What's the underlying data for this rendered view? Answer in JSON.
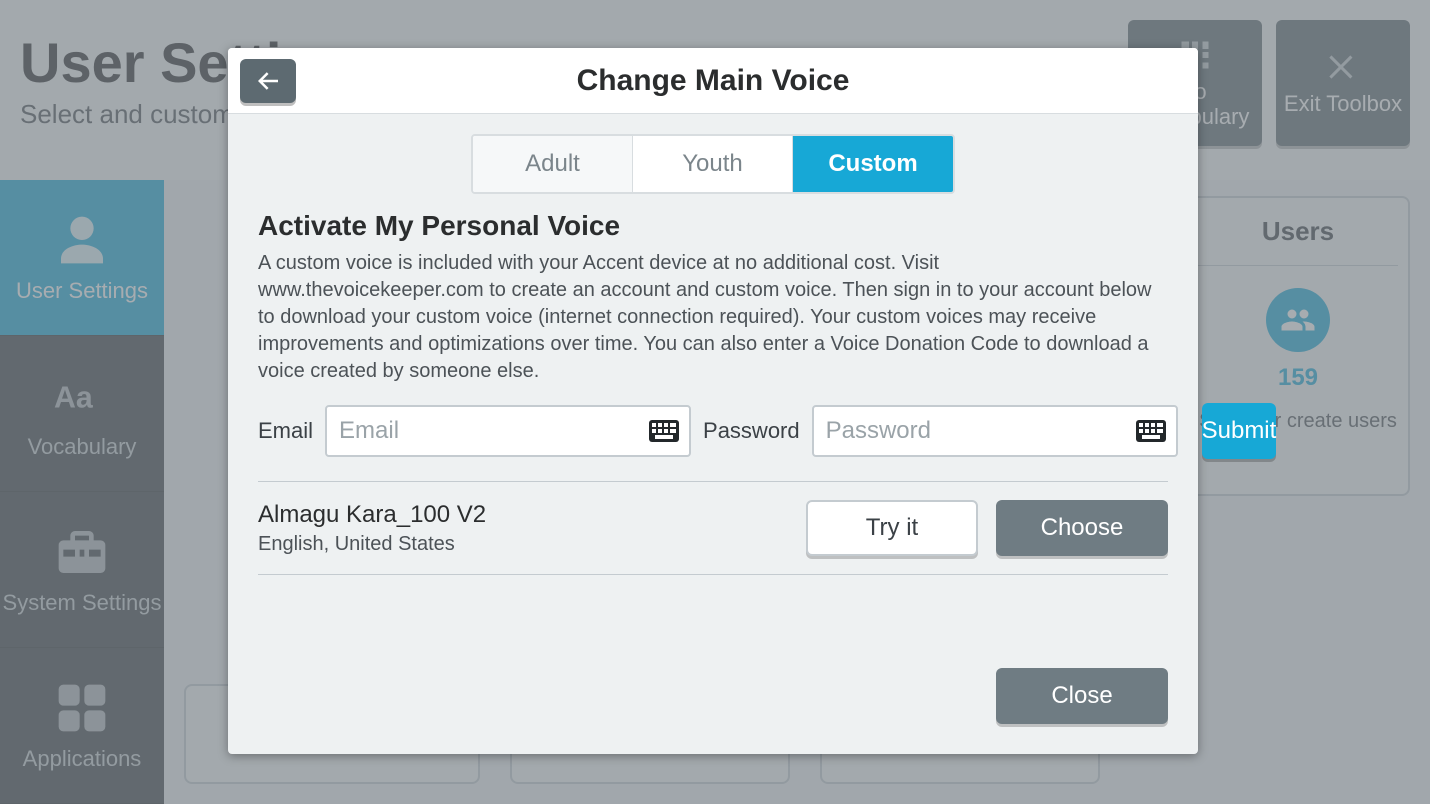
{
  "background": {
    "title": "User Settings",
    "subtitle": "Select and customize",
    "top_buttons": {
      "vocab": "To Vocabulary",
      "exit": "Exit Toolbox"
    },
    "sidebar": [
      {
        "label": "User Settings"
      },
      {
        "label": "Vocabulary"
      },
      {
        "label": "System Settings"
      },
      {
        "label": "Applications"
      }
    ],
    "users_panel": {
      "title": "Users",
      "count": "159",
      "desc": "Switch or create users"
    }
  },
  "modal": {
    "title": "Change Main Voice",
    "tabs": {
      "adult": "Adult",
      "youth": "Youth",
      "custom": "Custom"
    },
    "section_title": "Activate My Personal Voice",
    "section_desc": "A custom voice is included with your Accent device at no additional cost. Visit www.thevoicekeeper.com to create an account and custom voice. Then sign in to your account below to download your custom voice (internet connection required). Your custom voices may receive improvements and optimizations over time. You can also enter a Voice Donation Code to download a voice created by someone else.",
    "form": {
      "email_label": "Email",
      "email_placeholder": "Email",
      "password_label": "Password",
      "password_placeholder": "Password",
      "submit": "Submit"
    },
    "voice": {
      "name": "Almagu Kara_100 V2",
      "locale": "English, United States",
      "try": "Try it",
      "choose": "Choose"
    },
    "close": "Close"
  }
}
